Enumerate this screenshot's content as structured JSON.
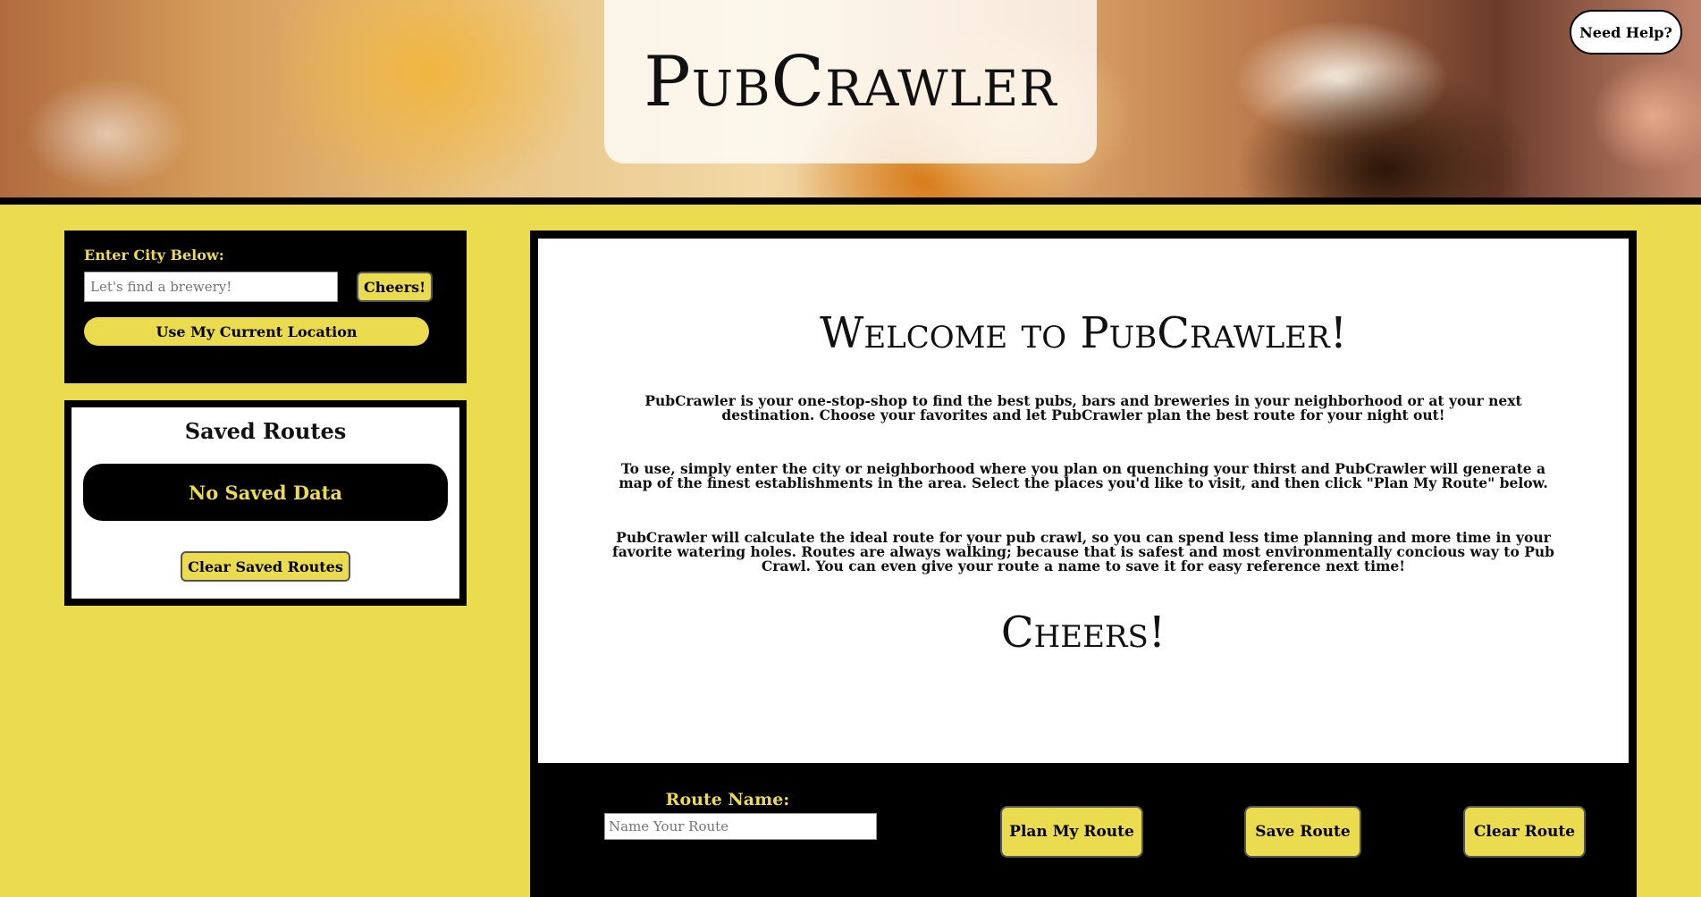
{
  "header": {
    "title": "PubCrawler",
    "help_label": "Need Help?"
  },
  "search": {
    "label": "Enter City Below:",
    "placeholder": "Let's find a brewery!",
    "value": "",
    "submit_label": "Cheers!",
    "location_label": "Use My Current Location"
  },
  "saved_routes": {
    "heading": "Saved Routes",
    "empty_text": "No Saved Data",
    "clear_label": "Clear Saved Routes"
  },
  "main": {
    "welcome_heading": "Welcome to PubCrawler!",
    "paragraph_1": "PubCrawler is your one-stop-shop to find the best pubs, bars and breweries in your neighborhood or at your next destination. Choose your favorites and let PubCrawler plan the best route for your night out!",
    "paragraph_2": "To use, simply enter the city or neighborhood where you plan on quenching your thirst and PubCrawler will generate a map of the finest establishments in the area. Select the places you'd like to visit, and then click \"Plan My Route\" below.",
    "paragraph_3": "PubCrawler will calculate the ideal route for your pub crawl, so you can spend less time planning and more time in your favorite watering holes. Routes are always walking; because that is safest and most environmentally concious way to Pub Crawl. You can even give your route a name to save it for easy reference next time!",
    "cheers_heading": "Cheers!"
  },
  "route_bar": {
    "name_label": "Route Name:",
    "name_placeholder": "Name Your Route",
    "name_value": "",
    "plan_label": "Plan My Route",
    "save_label": "Save Route",
    "clear_label": "Clear Route"
  },
  "colors": {
    "accent_yellow": "#ebdb4f",
    "panel_black": "#000000",
    "content_white": "#ffffff"
  }
}
